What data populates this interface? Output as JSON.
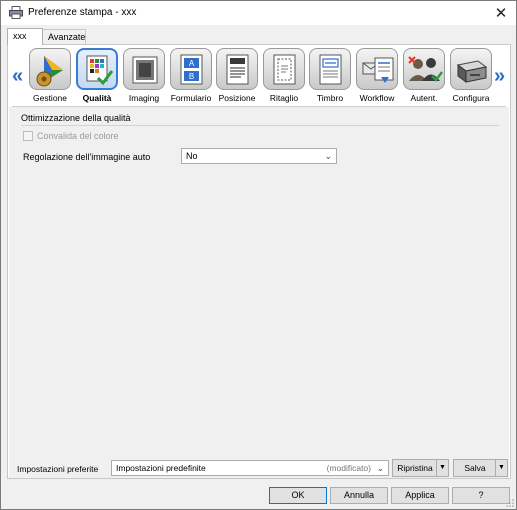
{
  "window": {
    "title": "Preferenze stampa - xxx",
    "close_icon": "close-icon"
  },
  "tabs": [
    {
      "label": "xxx",
      "active": true
    },
    {
      "label": "Avanzate",
      "active": false
    }
  ],
  "categories": [
    {
      "label": "Gestione",
      "icon": "gestione-icon",
      "selected": false
    },
    {
      "label": "Qualità",
      "icon": "qualita-icon",
      "selected": true
    },
    {
      "label": "Imaging",
      "icon": "imaging-icon",
      "selected": false
    },
    {
      "label": "Formulario",
      "icon": "formulario-icon",
      "selected": false
    },
    {
      "label": "Posizione",
      "icon": "posizione-icon",
      "selected": false
    },
    {
      "label": "Ritaglio",
      "icon": "ritaglio-icon",
      "selected": false
    },
    {
      "label": "Timbro",
      "icon": "timbro-icon",
      "selected": false
    },
    {
      "label": "Workflow",
      "icon": "workflow-icon",
      "selected": false
    },
    {
      "label": "Autent.",
      "icon": "autent-icon",
      "selected": false
    },
    {
      "label": "Configura",
      "icon": "configura-icon",
      "selected": false
    }
  ],
  "nav": {
    "prev": "«",
    "next": "»"
  },
  "quality": {
    "group_title": "Ottimizzazione della qualità",
    "color_check_label": "Convalida del colore",
    "color_check_enabled": false,
    "auto_image_label": "Regolazione dell'immagine auto",
    "auto_image_value": "No"
  },
  "preferences": {
    "label": "Impostazioni preferite",
    "value": "Impostazioni predefinite",
    "modified": "(modificato)",
    "restore_label": "Ripristina",
    "save_label": "Salva"
  },
  "footer": {
    "ok": "OK",
    "cancel": "Annulla",
    "apply": "Applica",
    "help": "?"
  },
  "colors": {
    "accent": "#3b7bd8",
    "nav_arrow": "#2a6ec2"
  }
}
